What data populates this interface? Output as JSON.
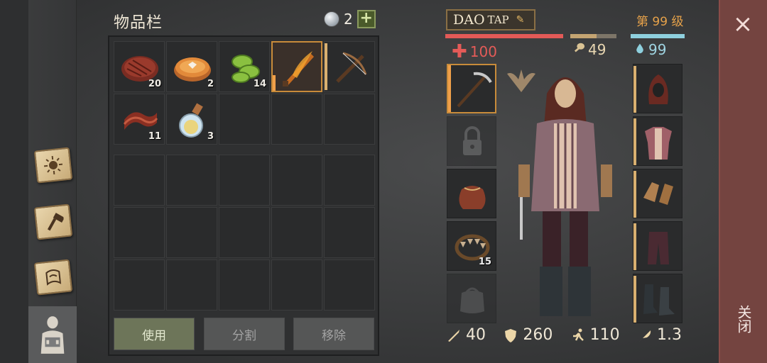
{
  "inventory": {
    "title": "物品栏",
    "currency_count": "2",
    "add_currency_label": "+",
    "slots": [
      {
        "icon": "steak-icon",
        "count": "20"
      },
      {
        "icon": "pie-icon",
        "count": "2"
      },
      {
        "icon": "cucumber-icon",
        "count": "14"
      },
      {
        "icon": "flaming-sword-icon",
        "count": "",
        "selected": true
      },
      {
        "icon": "crossbow-icon",
        "count": ""
      },
      {
        "icon": "bacon-icon",
        "count": "11"
      },
      {
        "icon": "potion-icon",
        "count": "3"
      }
    ],
    "actions": {
      "use": "使用",
      "split": "分割",
      "remove": "移除"
    }
  },
  "player": {
    "name_main": "DAO",
    "name_suffix": "TAP",
    "level": "第 99 级",
    "health": "100",
    "food": "49",
    "water": "99"
  },
  "stats": {
    "attack": "40",
    "defense": "260",
    "speed": "110",
    "weight": "1.3"
  },
  "equipment": {
    "left": [
      {
        "icon": "pickaxe-icon",
        "count": ""
      },
      {
        "icon": "lock-icon",
        "count": ""
      },
      {
        "icon": "pouch-icon",
        "count": ""
      },
      {
        "icon": "bear-trap-icon",
        "count": "15"
      },
      {
        "icon": "bag-icon",
        "count": ""
      }
    ],
    "right": [
      {
        "icon": "hood-icon"
      },
      {
        "icon": "tunic-icon"
      },
      {
        "icon": "gloves-icon"
      },
      {
        "icon": "trousers-icon"
      },
      {
        "icon": "boots-icon"
      }
    ]
  },
  "close": {
    "x": "×",
    "label": "关闭"
  },
  "colors": {
    "health": "#e25a57",
    "water": "#8ed0de",
    "level": "#e7a24a",
    "close_panel": "#744440"
  }
}
